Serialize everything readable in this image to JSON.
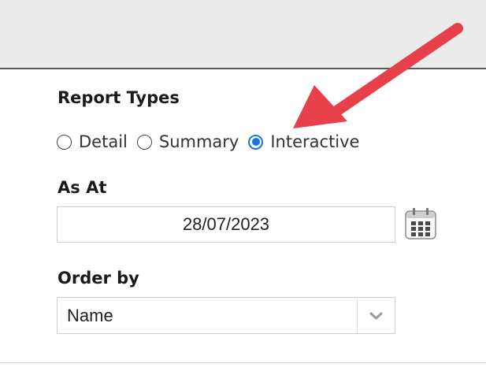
{
  "report_types": {
    "label": "Report Types",
    "options": [
      {
        "label": "Detail",
        "checked": false
      },
      {
        "label": "Summary",
        "checked": false
      },
      {
        "label": "Interactive",
        "checked": true
      }
    ]
  },
  "as_at": {
    "label": "As At",
    "value": "28/07/2023",
    "calendar_icon": "calendar-icon"
  },
  "order_by": {
    "label": "Order by",
    "selected": "Name",
    "dropdown_icon": "chevron-down-icon"
  },
  "annotation": {
    "arrow_color": "#e8404a"
  },
  "colors": {
    "accent": "#1a73e8",
    "header_bg": "#ebebeb"
  }
}
